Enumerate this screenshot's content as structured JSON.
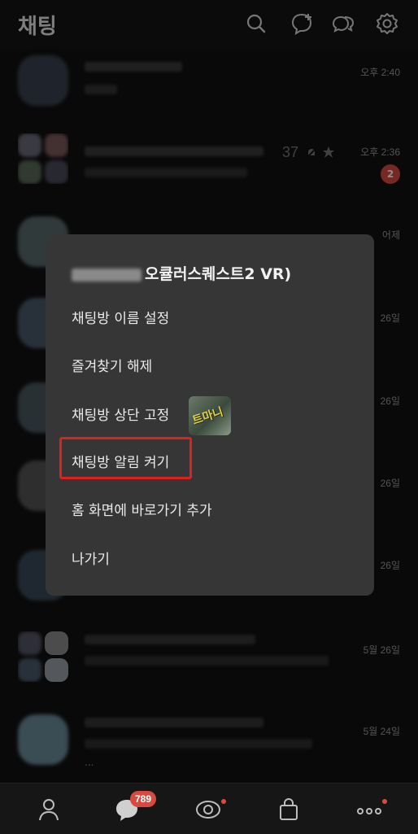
{
  "header": {
    "title": "채팅"
  },
  "icons": {
    "search": "search-icon",
    "new_chat": "chat-plus-icon",
    "open_chat": "open-chat-icon",
    "settings": "gear-icon"
  },
  "chat_list": [
    {
      "time": "오후 2:40"
    },
    {
      "time": "오후 2:36",
      "member_count": "37",
      "unread": "2"
    },
    {
      "time": "어제"
    },
    {
      "time": "26일"
    },
    {
      "time": "26일"
    },
    {
      "time": "26일"
    },
    {
      "time": "26일"
    },
    {
      "time": "5월 26일"
    },
    {
      "time": "5월 24일",
      "preview_tail": "..."
    }
  ],
  "context_menu": {
    "title": "오큘러스퀘스트2 VR)",
    "items": [
      "채팅방 이름 설정",
      "즐겨찾기 해제",
      "채팅방 상단 고정",
      "채팅방 알림 켜기",
      "홈 화면에 바로가기 추가",
      "나가기"
    ],
    "sticker_text": "트마니",
    "highlight_color": "#e02020"
  },
  "navbar": {
    "chat_badge": "789",
    "items": [
      "friends-icon",
      "chat-icon",
      "view-icon",
      "shopping-icon",
      "more-icon"
    ]
  }
}
